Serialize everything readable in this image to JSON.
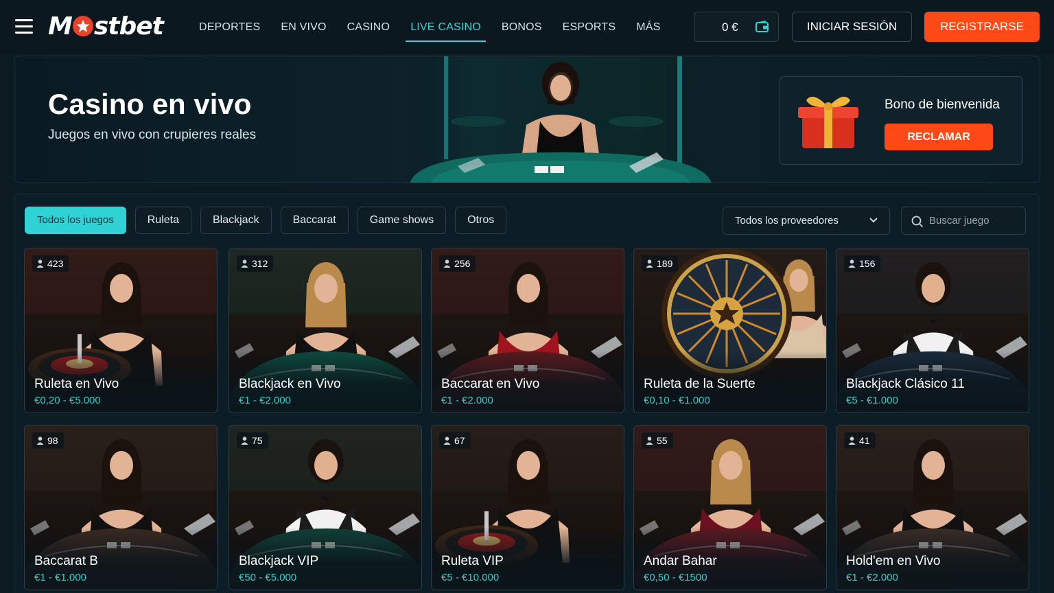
{
  "header": {
    "logo": "Mostbet",
    "nav": [
      "DEPORTES",
      "EN VIVO",
      "CASINO",
      "LIVE CASINO",
      "BONOS",
      "ESPORTS",
      "MÁS"
    ],
    "active_nav": "LIVE CASINO",
    "balance": "0 €",
    "login_label": "INICIAR SESIÓN",
    "register_label": "REGISTRARSE"
  },
  "banner": {
    "title": "Casino en vivo",
    "subtitle": "Juegos en vivo con crupieres reales",
    "bonus_title": "Bono de bienvenida",
    "bonus_button": "RECLAMAR"
  },
  "filters": {
    "chips": [
      "Todos los juegos",
      "Ruleta",
      "Blackjack",
      "Baccarat",
      "Game shows",
      "Otros"
    ],
    "active": "Todos los juegos",
    "provider_select": "Todos los proveedores",
    "search_placeholder": "Buscar juego"
  },
  "games": [
    {
      "name": "Ruleta en Vivo",
      "range": "€0,20 - €5.000",
      "players": "423",
      "table": "roulette",
      "felt": "#5c1a1a",
      "dealer": "woman-dark",
      "outfit": "#111111"
    },
    {
      "name": "Blackjack en Vivo",
      "range": "€1 - €2.000",
      "players": "312",
      "table": "blackjack",
      "felt": "#0f4a3f",
      "dealer": "woman-blonde",
      "outfit": "#111111"
    },
    {
      "name": "Baccarat en Vivo",
      "range": "€1 - €2.000",
      "players": "256",
      "table": "baccarat",
      "felt": "#5a1a1e",
      "dealer": "woman-dark",
      "outfit": "#a01420"
    },
    {
      "name": "Ruleta de la Suerte",
      "range": "€0,10 - €1.000",
      "players": "189",
      "table": "wheel",
      "felt": "#2a1a10",
      "dealer": "woman-blonde",
      "outfit": "#d9c4a6"
    },
    {
      "name": "Blackjack Clásico 11",
      "range": "€5 - €1.000",
      "players": "156",
      "table": "blackjack",
      "felt": "#1a2a3a",
      "dealer": "man",
      "outfit": "#1c1c1c"
    },
    {
      "name": "Baccarat B",
      "range": "€1 - €1.000",
      "players": "98",
      "table": "baccarat",
      "felt": "#3a2a22",
      "dealer": "woman-dark",
      "outfit": "#111111"
    },
    {
      "name": "Blackjack VIP",
      "range": "€50 - €5.000",
      "players": "75",
      "table": "blackjack",
      "felt": "#123f38",
      "dealer": "man",
      "outfit": "#1c1c1c"
    },
    {
      "name": "Ruleta VIP",
      "range": "€5 - €10.000",
      "players": "67",
      "table": "roulette",
      "felt": "#2c2420",
      "dealer": "woman-dark",
      "outfit": "#111111"
    },
    {
      "name": "Andar Bahar",
      "range": "€0,50 - €1500",
      "players": "55",
      "table": "baccarat",
      "felt": "#5a1a22",
      "dealer": "woman-blonde",
      "outfit": "#6a1020"
    },
    {
      "name": "Hold'em en Vivo",
      "range": "€1 - €2.000",
      "players": "41",
      "table": "blackjack",
      "felt": "#3a2c26",
      "dealer": "woman-dark",
      "outfit": "#111111"
    }
  ]
}
